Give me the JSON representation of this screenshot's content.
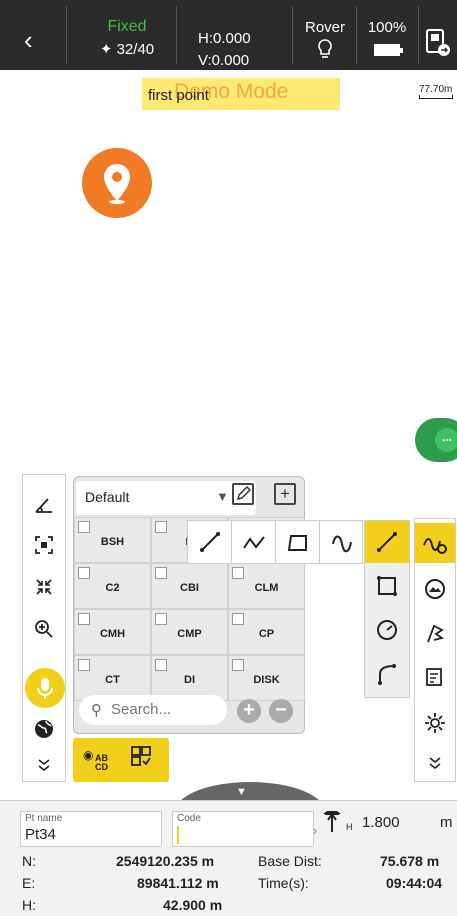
{
  "status": {
    "fix_state": "Fixed",
    "satellites": "32/40",
    "h_precision": "H:0.000",
    "v_precision": "V:0.000",
    "mode": "Rover",
    "battery": "100%",
    "fix_color": "#3fc03f"
  },
  "map": {
    "banner_point": "first point",
    "banner_demo": "Demo Mode",
    "scale_label": "77.70m",
    "more_label": "..."
  },
  "code_panel": {
    "library": "Default",
    "codes": [
      "BSH",
      "B",
      "",
      "C2",
      "CBI",
      "CLM",
      "CMH",
      "CMP",
      "CP",
      "CT",
      "DI",
      "DISK"
    ],
    "search_placeholder": "Search...",
    "pick_labels": {
      "ab": "AB",
      "cd": "CD"
    }
  },
  "info": {
    "pt_name_label": "Pt name",
    "pt_name": "Pt34",
    "code_label": "Code",
    "antenna_height": "1.800",
    "antenna_sub": "H",
    "antenna_unit": "m",
    "n_label": "N:",
    "n_value": "2549120.235 m",
    "e_label": "E:",
    "e_value": "89841.112 m",
    "h_label": "H:",
    "h_value": "42.900 m",
    "base_dist_label": "Base Dist:",
    "base_dist_value": "75.678 m",
    "time_label": "Time(s):",
    "time_value": "09:44:04"
  },
  "colors": {
    "accent": "#f2cf1a",
    "pin": "#f07a26",
    "more": "#40c062",
    "statusbar": "#2b2b2b"
  }
}
